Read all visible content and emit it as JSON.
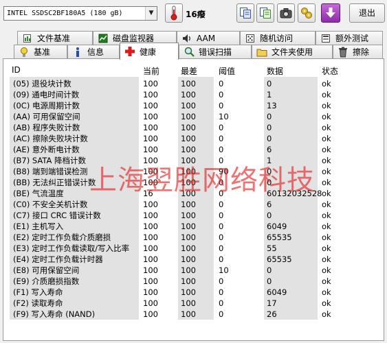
{
  "toolbar": {
    "drive": "INTEL SSDSC2BF180A5  (180 gB)",
    "temperature": "16癈",
    "exit_label": "退出"
  },
  "tabs_row1": [
    {
      "label": "文件基准",
      "icon": "file-benchmark-icon"
    },
    {
      "label": "磁盘监视器",
      "icon": "disk-monitor-icon"
    },
    {
      "label": "AAM",
      "icon": "speaker-icon"
    },
    {
      "label": "随机访问",
      "icon": "random-access-icon"
    },
    {
      "label": "额外测试",
      "icon": "extra-tests-icon"
    }
  ],
  "tabs_row2": [
    {
      "label": "基准",
      "icon": "benchmark-icon"
    },
    {
      "label": "信息",
      "icon": "info-icon"
    },
    {
      "label": "健康",
      "icon": "health-cross-icon",
      "active": true
    },
    {
      "label": "错误扫描",
      "icon": "magnifier-icon"
    },
    {
      "label": "文件夹使用",
      "icon": "folder-icon"
    },
    {
      "label": "擦除",
      "icon": "trash-icon"
    }
  ],
  "table": {
    "headers": {
      "id": "ID",
      "current": "当前",
      "worst": "最差",
      "threshold": "阈值",
      "data": "数据",
      "status": "状态"
    },
    "rows": [
      {
        "id": "(05) 退役块计数",
        "current": "100",
        "worst": "100",
        "threshold": "0",
        "data": "0",
        "status": "ok"
      },
      {
        "id": "(09) 通电时间计数",
        "current": "100",
        "worst": "100",
        "threshold": "0",
        "data": "1",
        "status": "ok"
      },
      {
        "id": "(0C) 电源周期计数",
        "current": "100",
        "worst": "100",
        "threshold": "0",
        "data": "13",
        "status": "ok"
      },
      {
        "id": "(AA) 可用保留空间",
        "current": "100",
        "worst": "100",
        "threshold": "10",
        "data": "0",
        "status": "ok"
      },
      {
        "id": "(AB) 程序失败计数",
        "current": "100",
        "worst": "100",
        "threshold": "0",
        "data": "0",
        "status": "ok"
      },
      {
        "id": "(AC) 擦除失败块计数",
        "current": "100",
        "worst": "100",
        "threshold": "0",
        "data": "0",
        "status": "ok"
      },
      {
        "id": "(AE) 意外断电计数",
        "current": "100",
        "worst": "100",
        "threshold": "0",
        "data": "6",
        "status": "ok"
      },
      {
        "id": "(B7) SATA 降档计数",
        "current": "100",
        "worst": "100",
        "threshold": "0",
        "data": "1",
        "status": "ok"
      },
      {
        "id": "(B8) 端到端错误检测",
        "current": "100",
        "worst": "100",
        "threshold": "90",
        "data": "0",
        "status": "ok"
      },
      {
        "id": "(BB) 无法纠正错误计数",
        "current": "100",
        "worst": "100",
        "threshold": "0",
        "data": "0",
        "status": "ok"
      },
      {
        "id": "(BE) 气流温度",
        "current": "16",
        "worst": "100",
        "threshold": "0",
        "data": "60132032528",
        "status": "ok"
      },
      {
        "id": "(C0) 不安全关机计数",
        "current": "100",
        "worst": "100",
        "threshold": "0",
        "data": "6",
        "status": "ok"
      },
      {
        "id": "(C7) 接口 CRC 错误计数",
        "current": "100",
        "worst": "100",
        "threshold": "0",
        "data": "0",
        "status": "ok"
      },
      {
        "id": "(E1) 主机写入",
        "current": "100",
        "worst": "100",
        "threshold": "0",
        "data": "6049",
        "status": "ok"
      },
      {
        "id": "(E2) 定时工作负载介质磨损",
        "current": "100",
        "worst": "100",
        "threshold": "0",
        "data": "65535",
        "status": "ok"
      },
      {
        "id": "(E3) 定时工作负载读取/写入比率",
        "current": "100",
        "worst": "100",
        "threshold": "0",
        "data": "55",
        "status": "ok"
      },
      {
        "id": "(E4) 定时工作负载计时器",
        "current": "100",
        "worst": "100",
        "threshold": "0",
        "data": "65535",
        "status": "ok"
      },
      {
        "id": "(E8) 可用保留空间",
        "current": "100",
        "worst": "100",
        "threshold": "10",
        "data": "0",
        "status": "ok"
      },
      {
        "id": "(E9) 介质磨损指数",
        "current": "100",
        "worst": "100",
        "threshold": "0",
        "data": "0",
        "status": "ok"
      },
      {
        "id": "(F1) 写入寿命",
        "current": "100",
        "worst": "100",
        "threshold": "0",
        "data": "6049",
        "status": "ok"
      },
      {
        "id": "(F2) 读取寿命",
        "current": "100",
        "worst": "100",
        "threshold": "0",
        "data": "17",
        "status": "ok"
      },
      {
        "id": "(F9) 写入寿命 (NAND)",
        "current": "100",
        "worst": "100",
        "threshold": "0",
        "data": "26",
        "status": "ok"
      }
    ]
  },
  "watermark": "上海翌胜网络科技"
}
